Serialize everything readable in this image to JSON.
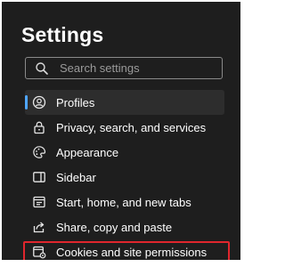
{
  "settings": {
    "title": "Settings",
    "search": {
      "placeholder": "Search settings",
      "icon": "search-icon"
    },
    "nav": [
      {
        "label": "Profiles",
        "icon": "profile-icon",
        "active": true
      },
      {
        "label": "Privacy, search, and services",
        "icon": "lock-icon"
      },
      {
        "label": "Appearance",
        "icon": "appearance-icon"
      },
      {
        "label": "Sidebar",
        "icon": "sidebar-icon"
      },
      {
        "label": "Start, home, and new tabs",
        "icon": "start-home-icon"
      },
      {
        "label": "Share, copy and paste",
        "icon": "share-icon"
      },
      {
        "label": "Cookies and site permissions",
        "icon": "cookies-site-permissions-icon",
        "highlighted": true
      }
    ],
    "colors": {
      "panel_bg": "#1e1e1e",
      "active_indicator": "#4fa6ff",
      "highlight_border": "#e0262d"
    }
  }
}
